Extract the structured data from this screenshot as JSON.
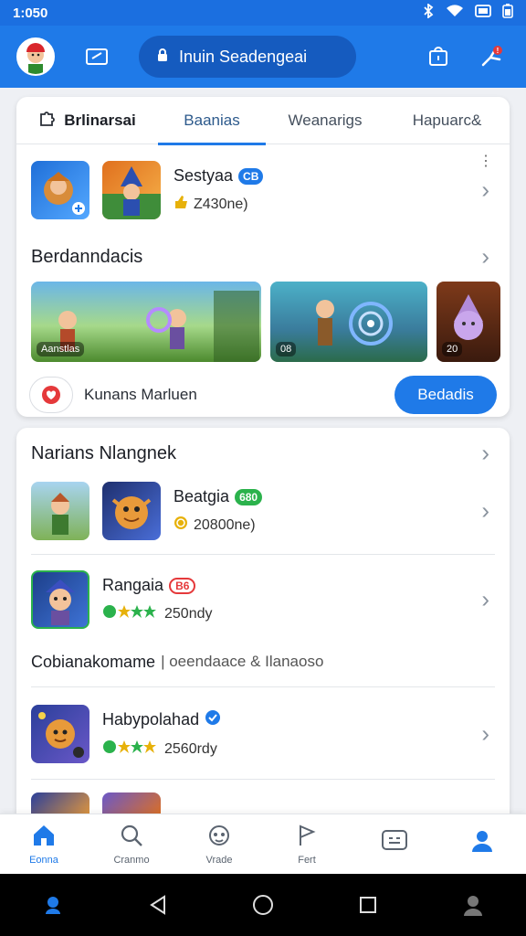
{
  "status_bar": {
    "time": "1:050"
  },
  "app_bar": {
    "search_label": "Inuin Seadengeai"
  },
  "tabs": [
    {
      "label": "Brlinarsai"
    },
    {
      "label": "Baanias"
    },
    {
      "label": "Weanarigs"
    },
    {
      "label": "Hapuarc&"
    }
  ],
  "card1": {
    "featured": {
      "title": "Sestyaa",
      "badge": "CB",
      "meta": "Z430ne)"
    },
    "section_title": "Berdanndacis",
    "banners": [
      {
        "label": "Aanstlas"
      },
      {
        "label": "08"
      },
      {
        "label": "20"
      }
    ],
    "footer": {
      "label": "Kunans Marluen",
      "cta": "Bedadis"
    }
  },
  "card2": {
    "section_title": "Narians Nlangnek",
    "games": [
      {
        "title": "Beatgia",
        "badge": "680",
        "meta": "20800ne)"
      },
      {
        "title": "Rangaia",
        "badge": "B6",
        "meta": "250ndy"
      }
    ],
    "subheading": "Cobianakomame",
    "subheading_secondary": "| oeendaace & Ilanaoso",
    "game3": {
      "title": "Habypolahad",
      "meta": "2560rdy"
    }
  },
  "bottom_nav": [
    {
      "label": "Eonna"
    },
    {
      "label": "Cranmo"
    },
    {
      "label": "Vrade"
    },
    {
      "label": "Fert"
    },
    {
      "label": ""
    },
    {
      "label": ""
    }
  ],
  "colors": {
    "accent": "#1f7ae8",
    "statusbar": "#1b6fe0",
    "green_badge": "#2bb24c",
    "red_badge": "#e5393b"
  }
}
